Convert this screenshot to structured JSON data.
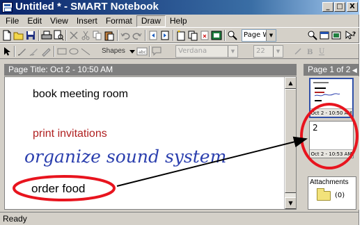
{
  "window": {
    "title": "Untitled * - SMART Notebook",
    "minimize": "_",
    "maximize": "□",
    "close": "X"
  },
  "menu": [
    "File",
    "Edit",
    "View",
    "Insert",
    "Format",
    "Draw",
    "Help"
  ],
  "toolbar1": {
    "zoom_value": "Page Wic",
    "icons": [
      "new-icon",
      "open-icon",
      "save-icon",
      "print-icon",
      "print-preview-icon",
      "cut-icon",
      "cut2-icon",
      "copy-icon",
      "paste-icon",
      "undo-icon",
      "redo-icon",
      "previous-page-icon",
      "next-page-icon",
      "insert-page-icon",
      "clone-page-icon",
      "delete-page-icon",
      "screen-capture-icon",
      "zoom-icon",
      "page-zoom-icon",
      "fit-icon",
      "screen-icon",
      "help-icon"
    ]
  },
  "toolbar2": {
    "shapes_label": "Shapes",
    "font_value": "Verdana",
    "size_value": "22",
    "icons": [
      "select-icon",
      "pen-icon",
      "creative-pen-icon",
      "eraser-icon",
      "rectangle-icon",
      "ellipse-icon",
      "line-icon",
      "text-icon",
      "fill-icon",
      "properties-icon",
      "bold-icon",
      "italic-icon",
      "underline-icon"
    ]
  },
  "page": {
    "title": "Page Title: Oct 2 - 10:50 AM",
    "notes": {
      "line1": "book meeting room",
      "line2": "print invitations",
      "line3": "organize sound system",
      "line4": "order food"
    }
  },
  "sorter": {
    "header": "Page 1 of 2",
    "pages": [
      {
        "caption": "Oct 2 - 10:50 AM"
      },
      {
        "number": "2",
        "caption": "Oct 2 - 10:53 AM"
      }
    ],
    "attachments_label": "Attachments",
    "attachments_count": "(0)"
  },
  "status": "Ready",
  "colors": {
    "annotation_red": "#e8141e",
    "ink_blue": "#2b3fae",
    "print_red": "#b02020"
  }
}
